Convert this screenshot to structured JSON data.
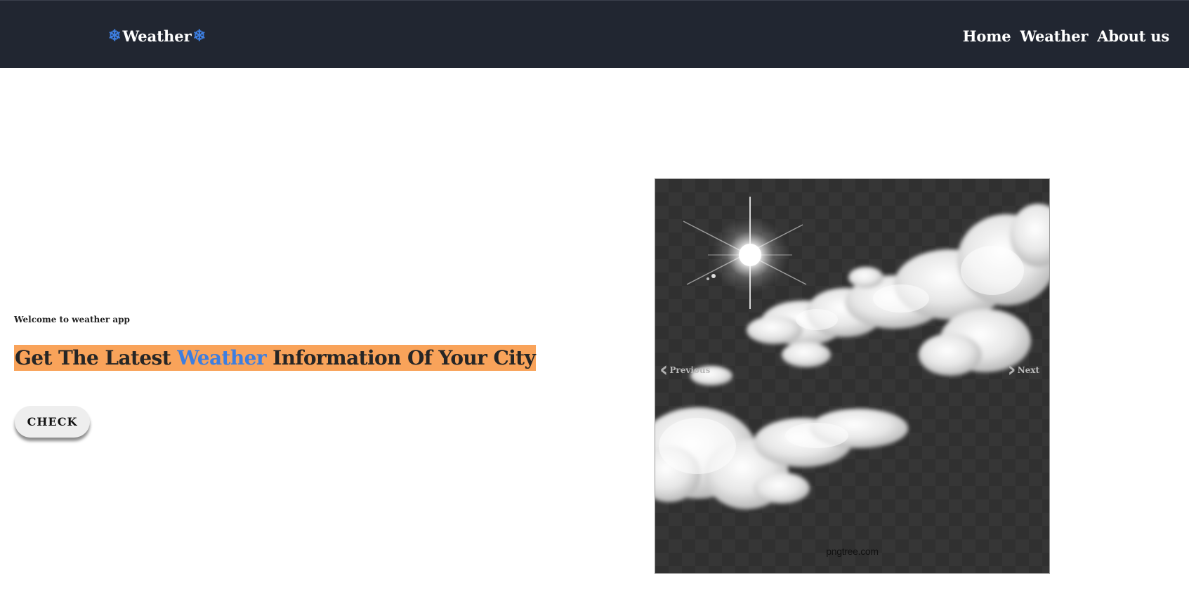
{
  "header": {
    "brand": {
      "icon_left": "snowflake-icon",
      "title": "Weather",
      "icon_right": "snowflake-icon"
    },
    "nav": [
      {
        "label": "Home"
      },
      {
        "label": "Weather"
      },
      {
        "label": "About us"
      }
    ]
  },
  "hero": {
    "welcome": "Welcome to weather app",
    "headline": {
      "before": "Get The Latest ",
      "accent": "Weather",
      "after": " Information Of Your City"
    },
    "button_label": "CHECK"
  },
  "carousel": {
    "prev_label": "Previous",
    "next_label": "Next",
    "image_watermark": "pngtree.com"
  },
  "colors": {
    "navbar": "#212631",
    "accent": "#3d7ee0",
    "highlight": "#f9a35a"
  }
}
